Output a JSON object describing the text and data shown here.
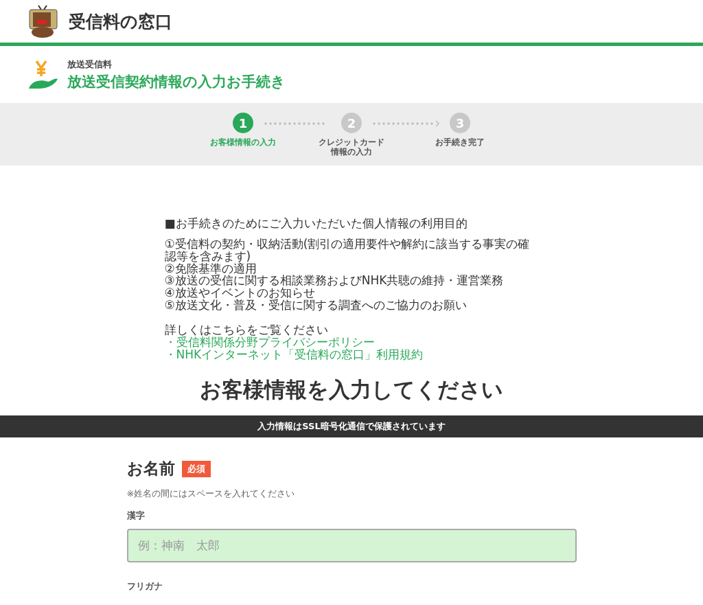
{
  "header": {
    "site_title": "受信料の窓口"
  },
  "subheader": {
    "category": "放送受信料",
    "title": "放送受信契約情報の入力お手続き"
  },
  "steps": [
    {
      "number": "1",
      "label_lines": [
        "お客様情報の入力"
      ],
      "selected": true
    },
    {
      "number": "2",
      "label_lines": [
        "クレジットカード",
        "情報の入力"
      ],
      "selected": false
    },
    {
      "number": "3",
      "label_lines": [
        "お手続き完了"
      ],
      "selected": false
    }
  ],
  "privacy": {
    "heading": "■お手続きのためにご入力いただいた個人情報の利用目的",
    "items": [
      "①受信料の契約・収納活動(割引の適用要件や解約に該当する事実の確認等を含みます)",
      "②免除基準の適用",
      "③放送の受信に関する相談業務およびNHK共聴の維持・運営業務",
      "④放送やイベントのお知らせ",
      "⑤放送文化・普及・受信に関する調査へのご協力のお願い"
    ],
    "details_intro": "詳しくはこちらをご覧ください",
    "links": [
      "・受信料関係分野プライバシーポリシー",
      "・NHKインターネット「受信料の窓口」利用規約"
    ]
  },
  "page_heading": "お客様情報を入力してください",
  "ssl_notice": "入力情報はSSL暗号化通信で保護されています",
  "form": {
    "section_title": "お名前",
    "required_badge": "必須",
    "note": "※姓名の間にはスペースを入れてください",
    "fields": [
      {
        "label": "漢字",
        "placeholder": "例：神南　太郎"
      },
      {
        "label": "フリガナ"
      }
    ]
  }
}
